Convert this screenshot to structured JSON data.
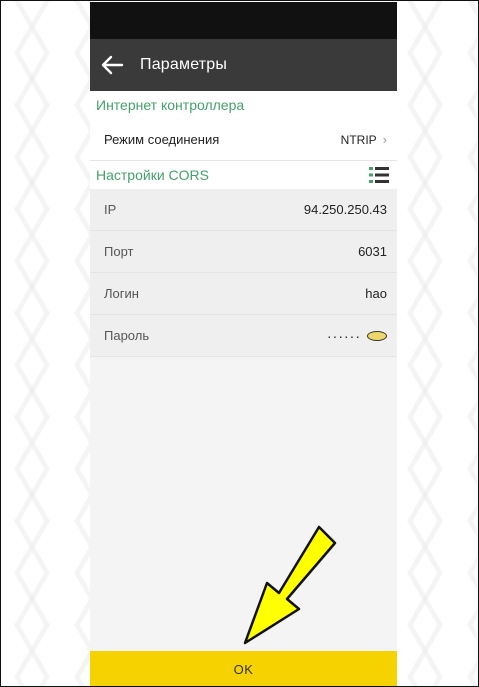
{
  "header": {
    "title": "Параметры"
  },
  "sections": {
    "internet": {
      "title": "Интернет контроллера",
      "connection_mode_label": "Режим соединения",
      "connection_mode_value": "NTRIP"
    },
    "cors": {
      "title": "Настройки CORS",
      "ip_label": "IP",
      "ip_value": "94.250.250.43",
      "port_label": "Порт",
      "port_value": "6031",
      "login_label": "Логин",
      "login_value": "hao",
      "password_label": "Пароль",
      "password_value": "······"
    }
  },
  "footer": {
    "ok_label": "OK"
  },
  "colors": {
    "accent_green": "#45a06b",
    "button_yellow": "#f6d200",
    "appbar": "#3a3a3a",
    "annotation_arrow": "#ffff00"
  },
  "icons": {
    "back": "arrow-left-icon",
    "list": "list-icon",
    "chevron": "chevron-right-icon",
    "eye": "eye-icon"
  }
}
